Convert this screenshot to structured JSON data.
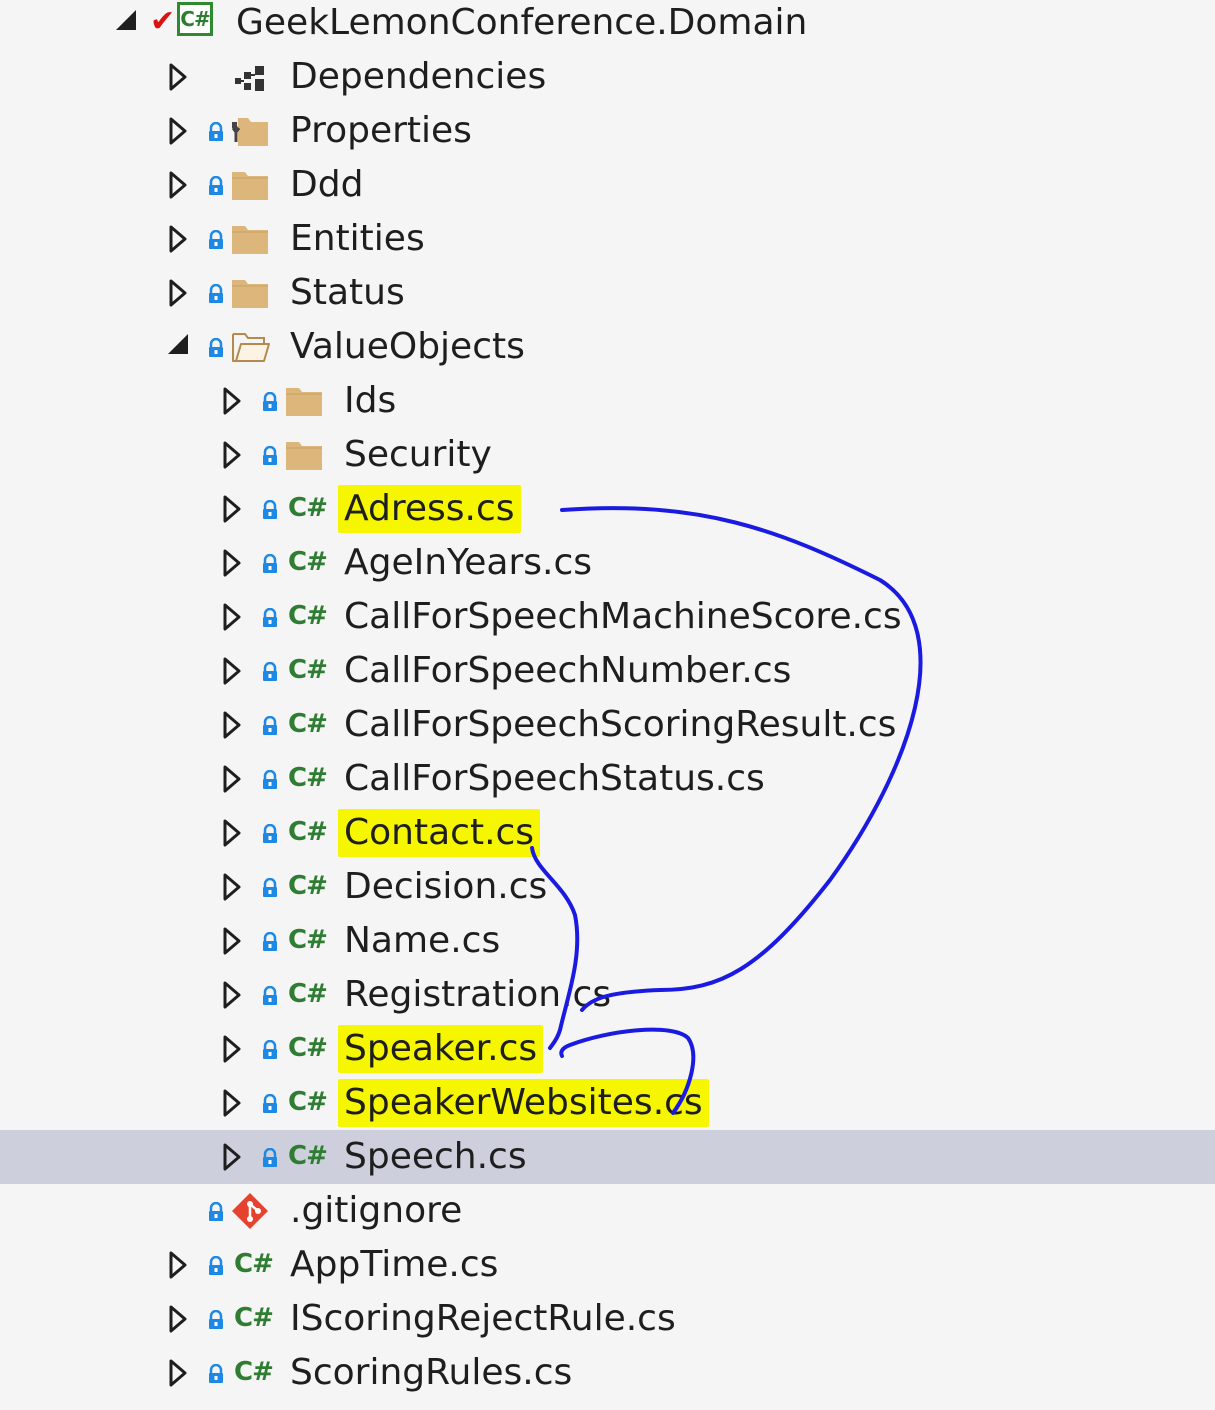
{
  "project": {
    "name": "GeekLemonConference.Domain",
    "icon": "csharp-project-icon",
    "status_icon": "check-icon"
  },
  "tree": [
    {
      "label": "Dependencies",
      "icon": "dependencies-icon",
      "level": 1,
      "expanded": false,
      "locked": false
    },
    {
      "label": "Properties",
      "icon": "properties-folder-icon",
      "level": 1,
      "expanded": false,
      "locked": true
    },
    {
      "label": "Ddd",
      "icon": "folder-icon",
      "level": 1,
      "expanded": false,
      "locked": true
    },
    {
      "label": "Entities",
      "icon": "folder-icon",
      "level": 1,
      "expanded": false,
      "locked": true
    },
    {
      "label": "Status",
      "icon": "folder-icon",
      "level": 1,
      "expanded": false,
      "locked": true
    },
    {
      "label": "ValueObjects",
      "icon": "open-folder-icon",
      "level": 1,
      "expanded": true,
      "locked": true
    },
    {
      "label": "Ids",
      "icon": "folder-icon",
      "level": 2,
      "expanded": false,
      "locked": true
    },
    {
      "label": "Security",
      "icon": "folder-icon",
      "level": 2,
      "expanded": false,
      "locked": true
    },
    {
      "label": "Adress.cs",
      "icon": "csharp-file-icon",
      "level": 2,
      "expanded": false,
      "locked": true,
      "highlighted": true
    },
    {
      "label": "AgeInYears.cs",
      "icon": "csharp-file-icon",
      "level": 2,
      "expanded": false,
      "locked": true
    },
    {
      "label": "CallForSpeechMachineScore.cs",
      "icon": "csharp-file-icon",
      "level": 2,
      "expanded": false,
      "locked": true
    },
    {
      "label": "CallForSpeechNumber.cs",
      "icon": "csharp-file-icon",
      "level": 2,
      "expanded": false,
      "locked": true
    },
    {
      "label": "CallForSpeechScoringResult.cs",
      "icon": "csharp-file-icon",
      "level": 2,
      "expanded": false,
      "locked": true
    },
    {
      "label": "CallForSpeechStatus.cs",
      "icon": "csharp-file-icon",
      "level": 2,
      "expanded": false,
      "locked": true
    },
    {
      "label": "Contact.cs",
      "icon": "csharp-file-icon",
      "level": 2,
      "expanded": false,
      "locked": true,
      "highlighted": true
    },
    {
      "label": "Decision.cs",
      "icon": "csharp-file-icon",
      "level": 2,
      "expanded": false,
      "locked": true
    },
    {
      "label": "Name.cs",
      "icon": "csharp-file-icon",
      "level": 2,
      "expanded": false,
      "locked": true
    },
    {
      "label": "Registration.cs",
      "icon": "csharp-file-icon",
      "level": 2,
      "expanded": false,
      "locked": true
    },
    {
      "label": "Speaker.cs",
      "icon": "csharp-file-icon",
      "level": 2,
      "expanded": false,
      "locked": true,
      "highlighted": true
    },
    {
      "label": "SpeakerWebsites.cs",
      "icon": "csharp-file-icon",
      "level": 2,
      "expanded": false,
      "locked": true,
      "highlighted": true
    },
    {
      "label": "Speech.cs",
      "icon": "csharp-file-icon",
      "level": 2,
      "expanded": false,
      "locked": true,
      "selected": true
    },
    {
      "label": ".gitignore",
      "icon": "git-icon",
      "level": 1,
      "expanded": null,
      "locked": true
    },
    {
      "label": "AppTime.cs",
      "icon": "csharp-file-icon",
      "level": 1,
      "expanded": false,
      "locked": true
    },
    {
      "label": "IScoringRejectRule.cs",
      "icon": "csharp-file-icon",
      "level": 1,
      "expanded": false,
      "locked": true
    },
    {
      "label": "ScoringRules.cs",
      "icon": "csharp-file-icon",
      "level": 1,
      "expanded": false,
      "locked": true
    }
  ],
  "colors": {
    "highlight": "#f6f600",
    "annotation": "#1a1ae0",
    "selection": "#cdd0dc",
    "lock": "#1e88e5",
    "folder": "#dcb67a",
    "csharp": "#2f7d32",
    "git": "#e5432d"
  }
}
